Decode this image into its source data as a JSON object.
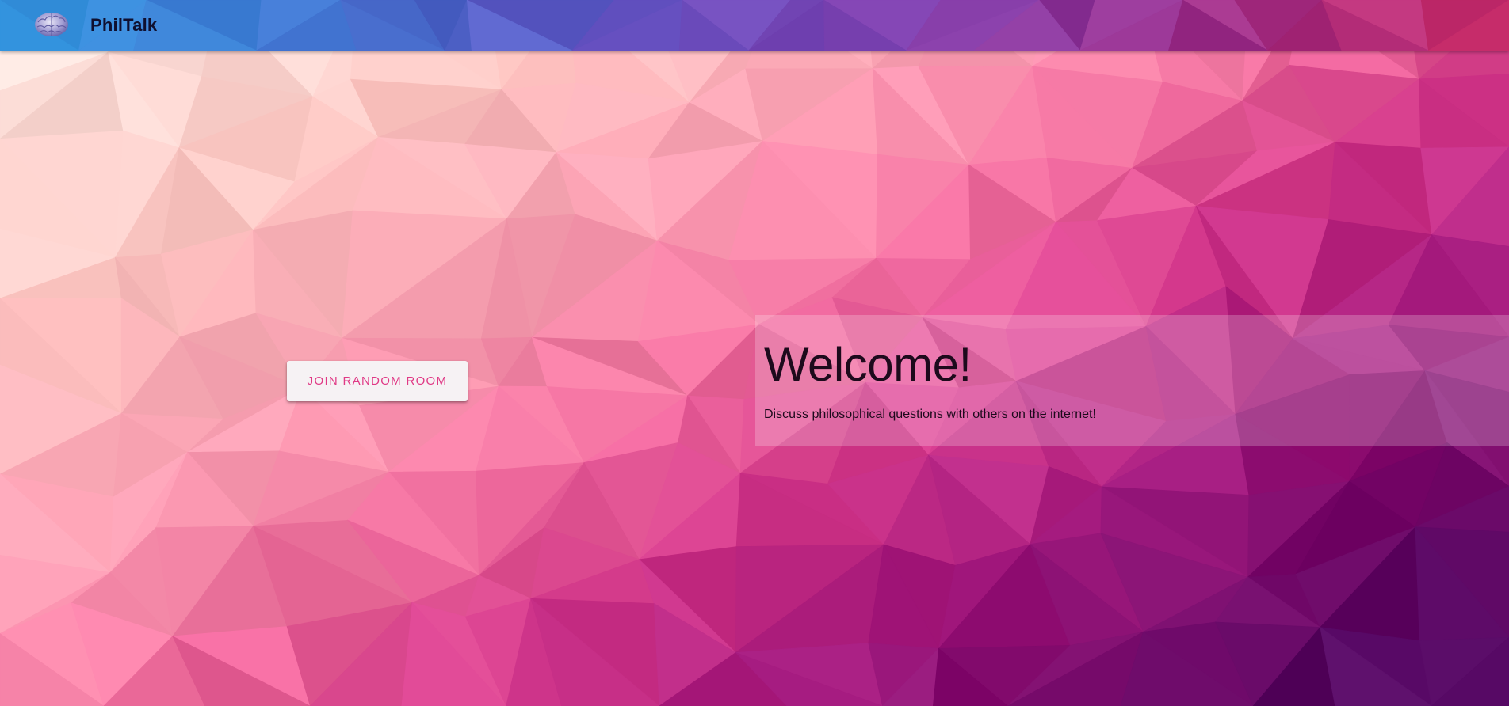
{
  "app": {
    "title": "PhilTalk",
    "logo_icon": "brain-icon"
  },
  "main": {
    "join_button_label": "JOIN RANDOM ROOM",
    "welcome_title": "Welcome!",
    "welcome_subtitle": "Discuss philosophical questions with others on the internet!"
  },
  "colors": {
    "accent": "#e03a86",
    "button_bg": "#f6f2f4",
    "text_dark": "#1d0a1c"
  }
}
